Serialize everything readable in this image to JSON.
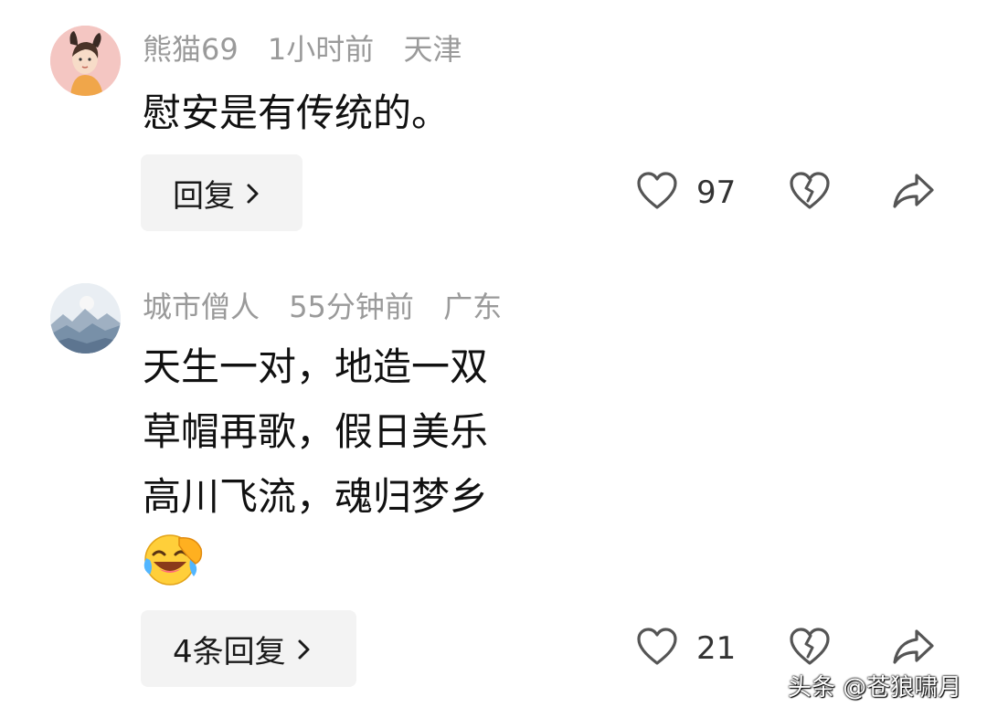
{
  "comments": [
    {
      "username": "熊猫69",
      "time": "1小时前",
      "location": "天津",
      "text_lines": [
        "慰安是有传统的。"
      ],
      "reply_label": "回复",
      "like_count": "97"
    },
    {
      "username": "城市僧人",
      "time": "55分钟前",
      "location": "广东",
      "text_lines": [
        "天生一对，地造一双",
        "草帽再歌，假日美乐",
        "高川飞流，魂归梦乡"
      ],
      "reply_label": "4条回复",
      "like_count": "21"
    }
  ],
  "watermark": "头条 @苍狼啸月",
  "icons": {
    "like": "heart-outline-icon",
    "dislike": "broken-heart-icon",
    "share": "share-arrow-icon",
    "reply_chevron": "chevron-right-icon",
    "emoji": "laughing-tears-emoji"
  }
}
